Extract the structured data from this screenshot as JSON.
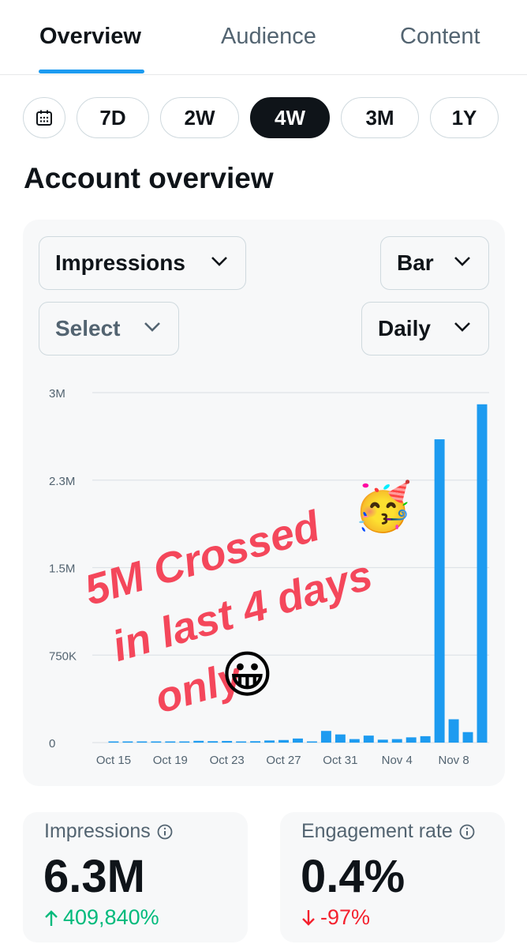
{
  "tabs": [
    {
      "label": "Overview",
      "active": true
    },
    {
      "label": "Audience",
      "active": false
    },
    {
      "label": "Content",
      "active": false
    }
  ],
  "ranges": [
    "7D",
    "2W",
    "4W",
    "3M",
    "1Y"
  ],
  "active_range": "4W",
  "section_title": "Account overview",
  "controls": {
    "metric": "Impressions",
    "chart_type": "Bar",
    "compare": "Select",
    "interval": "Daily"
  },
  "chart_data": {
    "type": "bar",
    "categories": [
      "Oct 14",
      "Oct 15",
      "Oct 16",
      "Oct 17",
      "Oct 18",
      "Oct 19",
      "Oct 20",
      "Oct 21",
      "Oct 22",
      "Oct 23",
      "Oct 24",
      "Oct 25",
      "Oct 26",
      "Oct 27",
      "Oct 28",
      "Oct 29",
      "Oct 30",
      "Oct 31",
      "Nov 1",
      "Nov 2",
      "Nov 3",
      "Nov 4",
      "Nov 5",
      "Nov 6",
      "Nov 7",
      "Nov 8",
      "Nov 9",
      "Nov 10"
    ],
    "values": [
      0,
      1000,
      2000,
      3000,
      5000,
      6000,
      8000,
      15000,
      12000,
      14000,
      10000,
      12000,
      18000,
      22000,
      35000,
      10000,
      100000,
      70000,
      30000,
      60000,
      25000,
      30000,
      45000,
      55000,
      2600000,
      200000,
      90000,
      2900000
    ],
    "x_ticks": [
      "Oct 15",
      "Oct 19",
      "Oct 23",
      "Oct 27",
      "Oct 31",
      "Nov 4",
      "Nov 8"
    ],
    "y_ticks": [
      "0",
      "750K",
      "1.5M",
      "2.3M",
      "3M"
    ],
    "ylim": [
      0,
      3000000
    ],
    "color": "#1d9bf0",
    "grid": true
  },
  "overlay": {
    "lines": [
      "5M Crossed",
      "in last 4 days",
      "only"
    ],
    "color": "#f4475b",
    "emoji_party": "🥳",
    "emoji_grin": "😀"
  },
  "metrics": [
    {
      "label": "Impressions",
      "value": "6.3M",
      "change": "409,840%",
      "direction": "up"
    },
    {
      "label": "Engagement rate",
      "value": "0.4%",
      "change": "-97%",
      "direction": "down"
    }
  ],
  "colors": {
    "accent": "#1d9bf0",
    "positive": "#00ba7c",
    "negative": "#f4212e"
  }
}
